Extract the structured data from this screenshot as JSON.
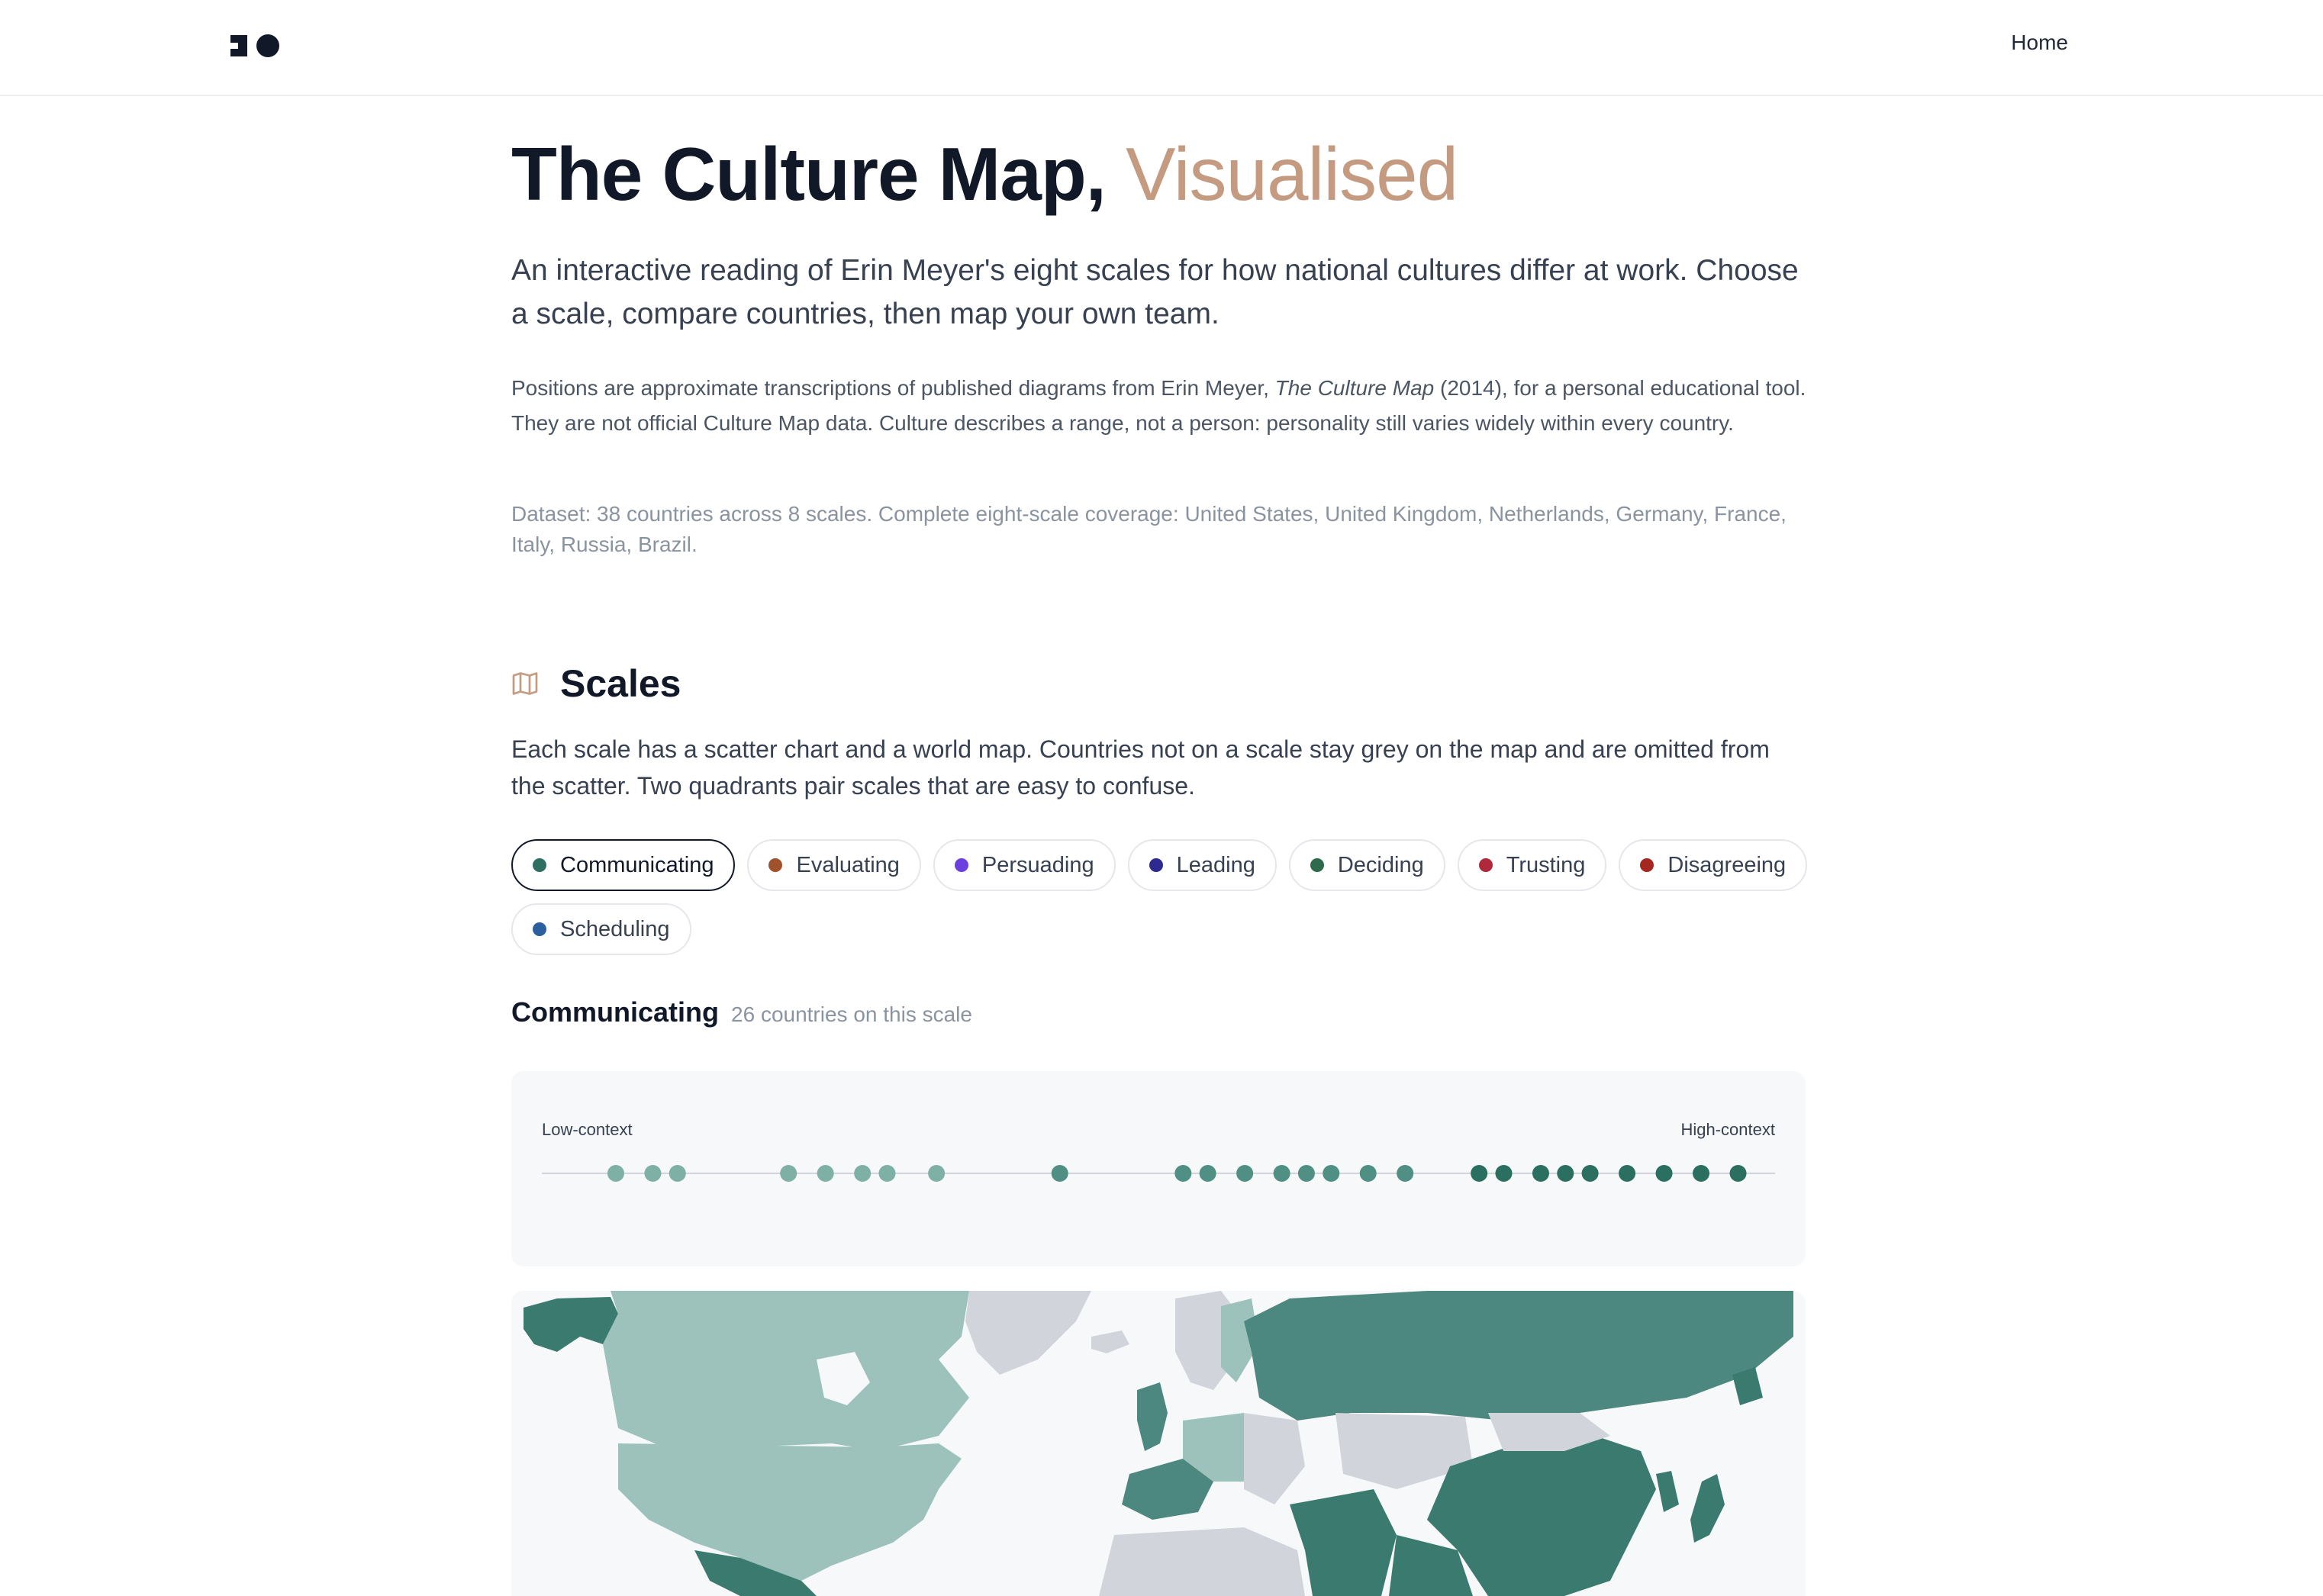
{
  "nav": {
    "home_label": "Home"
  },
  "hero": {
    "title_main": "The Culture Map,",
    "title_accent": "Visualised",
    "lead": "An interactive reading of Erin Meyer's eight scales for how national cultures differ at work. Choose a scale, compare countries, then map your own team.",
    "note_before": "Positions are approximate transcriptions of published diagrams from Erin Meyer, ",
    "note_book": "The Culture Map",
    "note_after": " (2014), for a personal educational tool. They are not official Culture Map data. Culture describes a range, not a person: personality still varies widely within every country.",
    "dataset": "Dataset: 38 countries across 8 scales. Complete eight-scale coverage: United States, United Kingdom, Netherlands, Germany, France, Italy, Russia, Brazil."
  },
  "scales_section": {
    "heading": "Scales",
    "icon": "map-icon",
    "description": "Each scale has a scatter chart and a world map. Countries not on a scale stay grey on the map and are omitted from the scatter. Two quadrants pair scales that are easy to confuse.",
    "chips": [
      {
        "label": "Communicating",
        "color": "#2f6f62",
        "active": true
      },
      {
        "label": "Evaluating",
        "color": "#a0522d",
        "active": false
      },
      {
        "label": "Persuading",
        "color": "#6d3fe0",
        "active": false
      },
      {
        "label": "Leading",
        "color": "#2e2a8f",
        "active": false
      },
      {
        "label": "Deciding",
        "color": "#2e6b4c",
        "active": false
      },
      {
        "label": "Trusting",
        "color": "#b0283a",
        "active": false
      },
      {
        "label": "Disagreeing",
        "color": "#a5281f",
        "active": false
      },
      {
        "label": "Scheduling",
        "color": "#2c5f9e",
        "active": false
      }
    ]
  },
  "selected_scale": {
    "name": "Communicating",
    "count_text": "26 countries on this scale",
    "left_label": "Low-context",
    "right_label": "High-context"
  },
  "chart_data": {
    "type": "scatter",
    "title": "",
    "xlabel": "",
    "ylabel": "",
    "xlim": [
      0,
      100
    ],
    "x_left_label": "Low-context",
    "x_right_label": "High-context",
    "x": [
      6,
      9,
      11,
      20,
      23,
      26,
      28,
      32,
      42,
      52,
      54,
      57,
      60,
      62,
      64,
      67,
      70,
      76,
      78,
      81,
      83,
      85,
      88,
      91,
      94,
      97
    ],
    "point_colors": {
      "low": "#7fb0a6",
      "mid": "#4f8f84",
      "high": "#2b6f60"
    }
  },
  "map": {
    "colors": {
      "scale_low": "#9cc2bb",
      "scale_mid": "#4d8880",
      "scale_high": "#3a7a6f",
      "not_on_scale": "#d1d5db",
      "ocean": "#f7f8f9"
    }
  }
}
